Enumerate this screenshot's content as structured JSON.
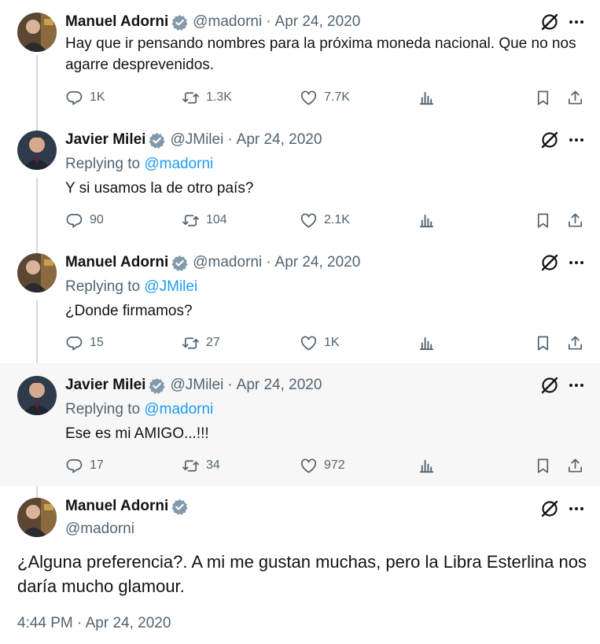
{
  "tweets": [
    {
      "name": "Manuel Adorni",
      "handle": "@madorni",
      "sep": "·",
      "date": "Apr 24, 2020",
      "text": "Hay que ir pensando nombres para la próxima moneda nacional. Que no nos agarre desprevenidos.",
      "reply_prefix": "",
      "reply_mention": "",
      "replies": "1K",
      "retweets": "1.3K",
      "likes": "7.7K",
      "avatar": "adorni"
    },
    {
      "name": "Javier Milei",
      "handle": "@JMilei",
      "sep": "·",
      "date": "Apr 24, 2020",
      "reply_prefix": "Replying to ",
      "reply_mention": "@madorni",
      "text": "Y si usamos la de otro país?",
      "replies": "90",
      "retweets": "104",
      "likes": "2.1K",
      "avatar": "milei"
    },
    {
      "name": "Manuel Adorni",
      "handle": "@madorni",
      "sep": "·",
      "date": "Apr 24, 2020",
      "reply_prefix": "Replying to ",
      "reply_mention": "@JMilei",
      "text": "¿Donde firmamos?",
      "replies": "15",
      "retweets": "27",
      "likes": "1K",
      "avatar": "adorni"
    },
    {
      "name": "Javier Milei",
      "handle": "@JMilei",
      "sep": "·",
      "date": "Apr 24, 2020",
      "reply_prefix": "Replying to ",
      "reply_mention": "@madorni",
      "text": "Ese es mi AMIGO...!!!",
      "replies": "17",
      "retweets": "34",
      "likes": "972",
      "avatar": "milei"
    }
  ],
  "main_tweet": {
    "name": "Manuel Adorni",
    "handle": "@madorni",
    "text": "¿Alguna preferencia?. A mi me gustan muchas, pero la Libra Esterlina nos daría mucho glamour.",
    "timestamp": "4:44 PM · Apr 24, 2020"
  },
  "icons": {
    "reply": "reply-icon",
    "retweet": "retweet-icon",
    "like": "heart-icon",
    "views": "views-icon",
    "bookmark": "bookmark-icon",
    "share": "share-icon",
    "grok": "grok-icon",
    "more": "more-icon",
    "verified": "verified-badge-icon"
  },
  "colors": {
    "text": "#0f1419",
    "secondary": "#536471",
    "link": "#1d9bf0",
    "highlight_bg": "#f7f7f7",
    "thread_line": "#cfd9de"
  }
}
